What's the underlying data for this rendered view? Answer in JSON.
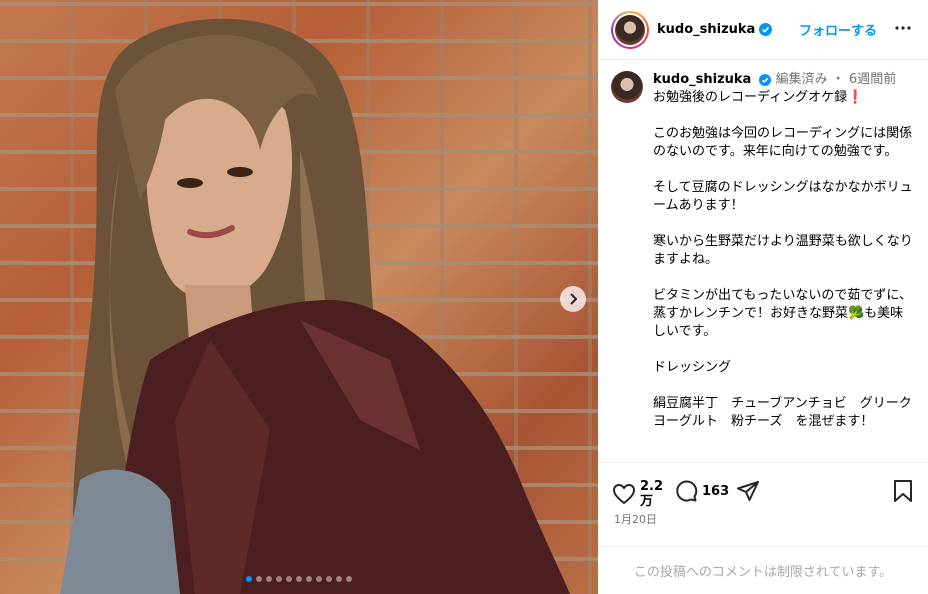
{
  "post": {
    "username": "kudo_shizuka",
    "follow_label": "フォローする",
    "edited_label": "編集済み",
    "separator": "・",
    "time_ago": "6週間前",
    "caption_paragraphs": [
      "お勉強後のレコーディングオケ録❗",
      "このお勉強は今回のレコーディングには関係のないのです。来年に向けての勉強です。",
      "そして豆腐のドレッシングはなかなかボリュームあります！",
      "寒いから生野菜だけより温野菜も欲しくなりますよね。",
      "ビタミンが出てもったいないので茹でずに、蒸すかレンチンで！お好きな野菜🥦も美味しいです。",
      "ドレッシング",
      "絹豆腐半丁　チューブアンチョビ　グリークヨーグルト　粉チーズ　を混ぜます！"
    ],
    "likes": "2.2\n万",
    "likes_num": "2.2",
    "likes_unit": "万",
    "comments_count": "163",
    "date": "1月20日",
    "comments_disabled_text": "この投稿へのコメントは制限されています。"
  },
  "carousel": {
    "total": 11,
    "active_index": 0
  },
  "icons": {
    "verified": "verified-badge-icon",
    "more": "more-horizontal-icon",
    "like": "heart-icon",
    "comment": "comment-bubble-icon",
    "share": "paper-plane-icon",
    "save": "bookmark-icon",
    "next": "chevron-right-icon"
  },
  "colors": {
    "link_blue": "#0095f6",
    "muted_gray": "#737373",
    "border": "#efefef"
  }
}
